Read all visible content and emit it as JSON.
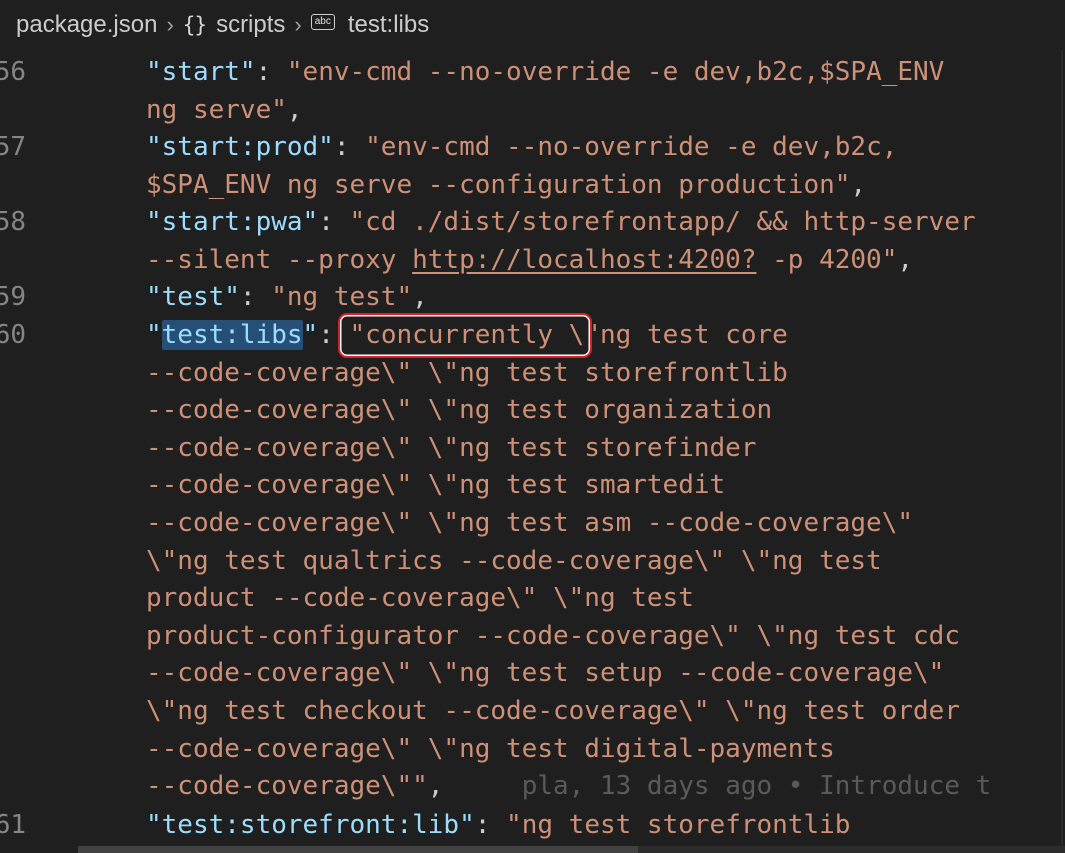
{
  "breadcrumb": {
    "file": "package.json",
    "section": "scripts",
    "item": "test:libs",
    "braces_glyph": "{}",
    "abc_glyph": "abc"
  },
  "colors": {
    "background": "#1f1f1f",
    "key": "#9cdcfe",
    "string": "#ce9178",
    "line_number": "#858585",
    "selection": "#264f78",
    "highlight_box": "#d8202b"
  },
  "editor": {
    "line_numbers": [
      "56",
      "57",
      "58",
      "59",
      "60",
      "61"
    ],
    "lines": {
      "l56a_key": "\"start\"",
      "l56a_val": "\"env-cmd --no-override -e dev,b2c,$SPA_ENV",
      "l56b": "ng serve\"",
      "l57a_key": "\"start:prod\"",
      "l57a_val": "\"env-cmd --no-override -e dev,b2c,",
      "l57b": "$SPA_ENV ng serve --configuration production\"",
      "l58a_key": "\"start:pwa\"",
      "l58a_val": "\"cd ./dist/storefrontapp/ && http-server",
      "l58b_pre": "--silent --proxy ",
      "l58b_link": "http://localhost:4200?",
      "l58b_post": " -p 4200\"",
      "l59_key": "\"test\"",
      "l59_val": "\"ng test\"",
      "l60_key_q1": "\"",
      "l60_key_text": "test:libs",
      "l60_key_q2": "\"",
      "l60_val_boxed": "\"concurrently \\",
      "l60_val_rest": "\"ng test core",
      "cont1": "--code-coverage\\\" \\\"ng test storefrontlib",
      "cont2": "--code-coverage\\\" \\\"ng test organization",
      "cont3": "--code-coverage\\\" \\\"ng test storefinder",
      "cont4": "--code-coverage\\\" \\\"ng test smartedit",
      "cont5": "--code-coverage\\\" \\\"ng test asm --code-coverage\\\"",
      "cont6": "\\\"ng test qualtrics --code-coverage\\\" \\\"ng test",
      "cont7": "product --code-coverage\\\" \\\"ng test",
      "cont8": "product-configurator --code-coverage\\\" \\\"ng test cdc",
      "cont9": "--code-coverage\\\" \\\"ng test setup --code-coverage\\\"",
      "cont10": "\\\"ng test checkout --code-coverage\\\" \\\"ng test order",
      "cont11": "--code-coverage\\\" \\\"ng test digital-payments",
      "cont12": "--code-coverage\\\"\"",
      "blame": "pla, 13 days ago • Introduce t",
      "l61_key": "\"test:storefront:lib\"",
      "l61_val": "\"ng test storefrontlib"
    }
  }
}
